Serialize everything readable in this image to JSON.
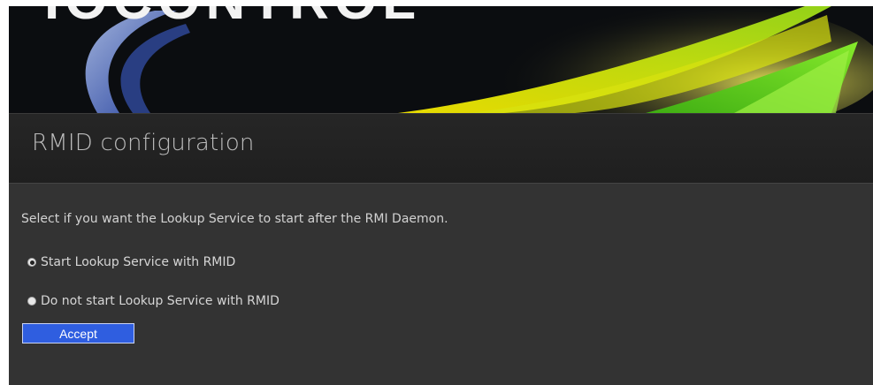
{
  "banner": {
    "logo_text": "IOCONTROL",
    "colors": {
      "background": "#0b0d10",
      "blue": "#6f8fe8",
      "yellow": "#e6e01c",
      "green": "#5fd21e"
    }
  },
  "page": {
    "title": "RMID configuration"
  },
  "form": {
    "instruction": "Select if you want the Lookup Service to start after the RMI Daemon.",
    "options": [
      {
        "label": "Start Lookup Service with RMID",
        "selected": true
      },
      {
        "label": "Do not start Lookup Service with RMID",
        "selected": false
      }
    ],
    "accept_label": "Accept"
  },
  "colors": {
    "panel": "#333333",
    "accent": "#2f5ee0"
  }
}
